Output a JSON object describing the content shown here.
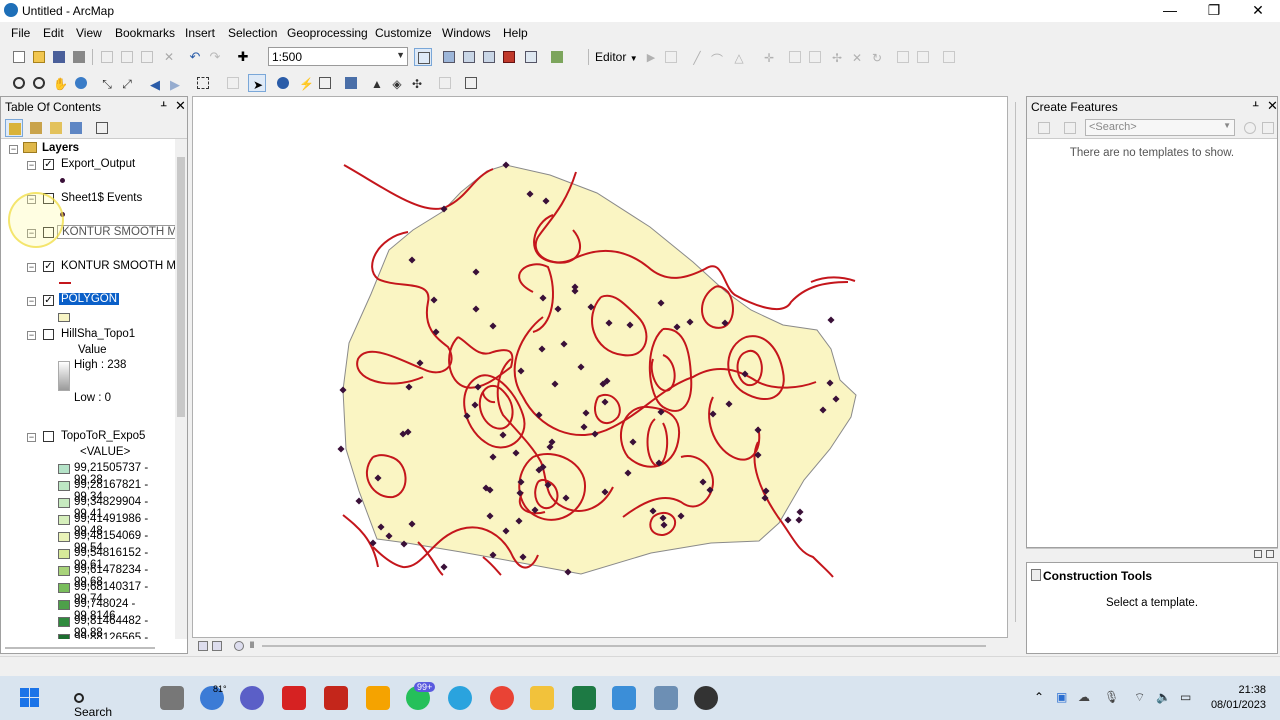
{
  "window": {
    "title": "Untitled - ArcMap",
    "minimize": "—",
    "maximize": "❐",
    "close": "✕"
  },
  "menu": [
    "File",
    "Edit",
    "View",
    "Bookmarks",
    "Insert",
    "Selection",
    "Geoprocessing",
    "Customize",
    "Windows",
    "Help"
  ],
  "toolbar": {
    "scale_value": "1:500",
    "editor_label": "Editor"
  },
  "toc": {
    "title": "Table Of Contents",
    "root": "Layers",
    "layers": {
      "export_output": {
        "name": "Export_Output",
        "checked": true
      },
      "sheet_events": {
        "name": "Sheet1$ Events",
        "checked": false
      },
      "kontur_minor": {
        "name": "KONTUR SMOOTH MINOR",
        "checked": false
      },
      "kontur_major": {
        "name": "KONTUR SMOOTH MA",
        "checked": true
      },
      "polygon": {
        "name": "POLYGON",
        "checked": true
      },
      "hillshade": {
        "name": "HillSha_Topo1",
        "checked": false,
        "value_label": "Value",
        "high": "High : 238",
        "low": "Low : 0"
      },
      "topotor": {
        "name": "TopoToR_Expo5",
        "checked": false,
        "value_label": "<VALUE>"
      }
    },
    "classes": [
      {
        "label": "99,21505737 - 99,28",
        "color": "#b5e3c8"
      },
      {
        "label": "99,28167821 - 99,34",
        "color": "#bde6c4"
      },
      {
        "label": "99,34829904 - 99,41",
        "color": "#c7eac0"
      },
      {
        "label": "99,41491986 - 99,48",
        "color": "#d6efbc"
      },
      {
        "label": "99,48154069 - 99,54",
        "color": "#e9f2b8"
      },
      {
        "label": "99,54816152 - 99,61",
        "color": "#d8e99a"
      },
      {
        "label": "99,61478234 - 99,68",
        "color": "#a8d37a"
      },
      {
        "label": "99,68140317 - 99,74",
        "color": "#79bd5c"
      },
      {
        "label": "99,748024 - 99,8146",
        "color": "#4ea04a"
      },
      {
        "label": "99,81464482 - 99,88",
        "color": "#2f8a3d"
      },
      {
        "label": "99,88126565 - 99,94",
        "color": "#1d6e30"
      }
    ]
  },
  "create_features": {
    "title": "Create Features",
    "search_placeholder": "<Search>",
    "empty_message": "There are no templates to show."
  },
  "construction_tools": {
    "title": "Construction Tools",
    "message": "Select a template."
  },
  "colors": {
    "polygon_fill": "#faf5c3",
    "polygon_stroke": "#8a8a8a",
    "contour": "#c4161c",
    "point": "#3a1038",
    "selection": "#0a5fc8"
  },
  "taskbar": {
    "search_label": "Search",
    "temperature": "81°",
    "whatsapp_badge": "99+",
    "time": "21:38",
    "date": "08/01/2023"
  }
}
